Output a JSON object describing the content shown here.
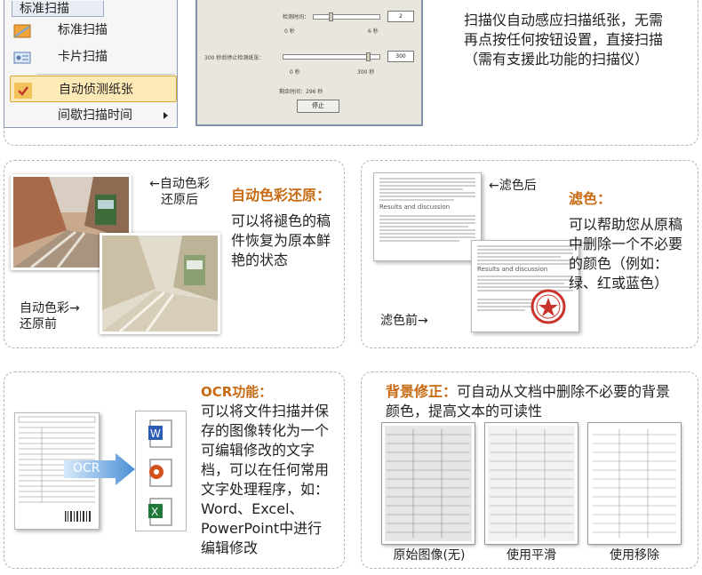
{
  "top": {
    "menu": {
      "title": "标准扫描",
      "items": [
        {
          "label": "标准扫描",
          "icon": "scanner-icon"
        },
        {
          "label": "卡片扫描",
          "icon": "card-icon"
        },
        {
          "label": "自动侦测纸张",
          "icon": "check-icon",
          "checked": true
        },
        {
          "label": "间歇扫描时间",
          "icon": "submenu-arrow-icon"
        }
      ]
    },
    "dialog": {
      "label_a": "检测时间：",
      "value_a": "2",
      "min_a": "0 秒",
      "max_a": "6 秒",
      "label_b": "300 秒后停止检测纸张：",
      "value_b": "300",
      "min_b": "0 秒",
      "max_b": "300 秒",
      "remaining": "剩余时间：296 秒",
      "stop_button": "停止"
    },
    "description": "扫描仪自动感应扫描纸张，无需再点按任何按钮设置，直接扫描（需有支援此功能的扫描仪）"
  },
  "color_restore": {
    "after_label": "←自动色彩\n还原后",
    "before_label": "自动色彩→\n还原前",
    "title": "自动色彩还原：",
    "desc": "可以将褪色的稿件恢复为原本鲜艳的状态"
  },
  "filter": {
    "after_label": "←滤色后",
    "before_label": "滤色前→",
    "doc_heading": "Results and discussion",
    "title": "滤色：",
    "desc": "可以帮助您从原稿中删除一个不必要的颜色（例如：绿、红或蓝色）"
  },
  "ocr": {
    "title": "OCR功能：",
    "desc": "可以将文件扫描并保存的图像转化为一个可编辑修改的文字档，可以在任何常用文字处理程序，如：Word、Excel、PowerPoint中进行编辑修改",
    "arrow_label": "OCR",
    "icons": [
      "word-icon",
      "powerpoint-icon",
      "excel-icon"
    ]
  },
  "background": {
    "title": "背景修正：",
    "desc": "可自动从文档中删除不必要的背景颜色，提高文本的可读性",
    "captions": [
      "原始图像(无)",
      "使用平滑",
      "使用移除"
    ]
  },
  "colors": {
    "accent_orange": "#c76a12",
    "panel_border": "#b8b2a8",
    "menu_highlight": "#fde9b6"
  }
}
